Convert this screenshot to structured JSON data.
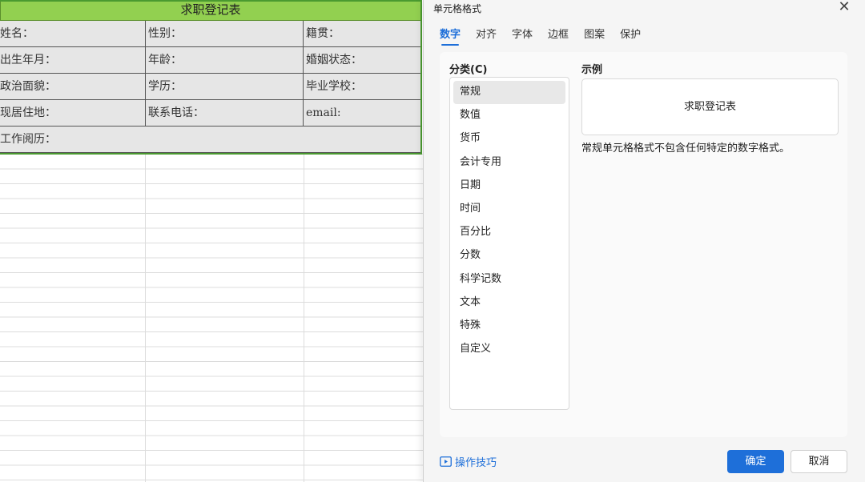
{
  "sheet": {
    "form_title": "求职登记表",
    "rows": [
      [
        "姓名：",
        "性别：",
        "籍贯："
      ],
      [
        "出生年月：",
        "年龄：",
        "婚姻状态："
      ],
      [
        "政治面貌：",
        "学历：",
        "毕业学校："
      ],
      [
        "现居住地：",
        "联系电话：",
        "email:"
      ],
      [
        "工作阅历："
      ]
    ]
  },
  "dialog": {
    "title": "单元格格式",
    "close_icon": "close-icon",
    "tabs": [
      "数字",
      "对齐",
      "字体",
      "边框",
      "图案",
      "保护"
    ],
    "active_tab": "数字",
    "category_label": "分类(C)",
    "categories": [
      "常规",
      "数值",
      "货币",
      "会计专用",
      "日期",
      "时间",
      "百分比",
      "分数",
      "科学记数",
      "文本",
      "特殊",
      "自定义"
    ],
    "selected_category": "常规",
    "sample_label": "示例",
    "sample_value": "求职登记表",
    "description": "常规单元格格式不包含任何特定的数字格式。",
    "tips_label": "操作技巧",
    "tips_icon": "play-icon",
    "ok_label": "确定",
    "cancel_label": "取消"
  },
  "colors": {
    "accent": "#1e6fd9",
    "title_fill": "#92d050",
    "cell_fill": "#e6e6e6"
  }
}
